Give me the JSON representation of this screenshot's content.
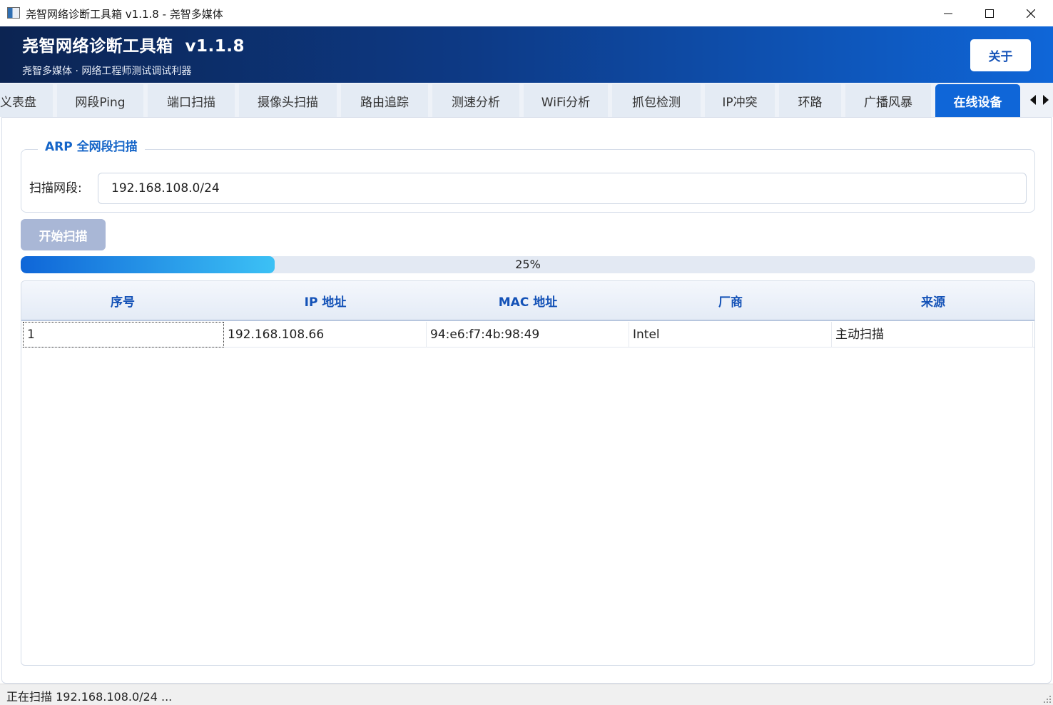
{
  "window": {
    "title": "尧智网络诊断工具箱 v1.1.8 - 尧智多媒体",
    "controls": [
      "minimize-icon",
      "maximize-icon",
      "close-icon"
    ]
  },
  "header": {
    "title": "尧智网络诊断工具箱  v1.1.8",
    "subtitle": "尧智多媒体 · 网络工程师测试调试利器",
    "about_label": "关于"
  },
  "tabs": [
    {
      "label": "义表盘",
      "active": false
    },
    {
      "label": "网段Ping",
      "active": false
    },
    {
      "label": "端口扫描",
      "active": false
    },
    {
      "label": "摄像头扫描",
      "active": false
    },
    {
      "label": "路由追踪",
      "active": false
    },
    {
      "label": "测速分析",
      "active": false
    },
    {
      "label": "WiFi分析",
      "active": false
    },
    {
      "label": "抓包检测",
      "active": false
    },
    {
      "label": "IP冲突",
      "active": false
    },
    {
      "label": "环路",
      "active": false
    },
    {
      "label": "广播风暴",
      "active": false
    },
    {
      "label": "在线设备",
      "active": true
    }
  ],
  "arp_scan": {
    "group_title": "ARP 全网段扫描",
    "subnet_label": "扫描网段:",
    "subnet_value": "192.168.108.0/24",
    "start_label": "开始扫描",
    "progress_fraction": 0.25,
    "progress_text": "25%"
  },
  "table": {
    "columns": [
      "序号",
      "IP 地址",
      "MAC 地址",
      "厂商",
      "来源"
    ],
    "rows": [
      [
        "1",
        "192.168.108.66",
        "94:e6:f7:4b:98:49",
        "Intel",
        "主动扫描"
      ]
    ]
  },
  "status": {
    "text": "正在扫描 192.168.108.0/24 ..."
  },
  "colors": {
    "accent": "#0f66d8",
    "banner_dark": "#0c2452",
    "header_text": "#1452b7",
    "button_disabled": "#a9b7d6"
  }
}
